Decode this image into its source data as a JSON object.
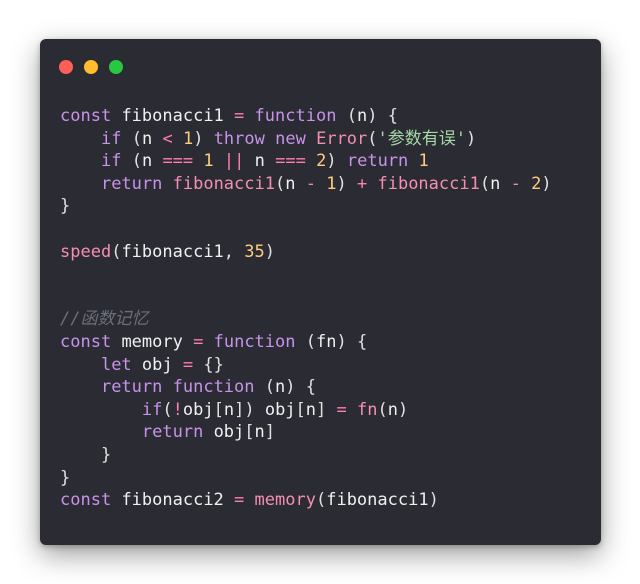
{
  "window": {
    "traffic_lights": {
      "close": {
        "icon": "close-dot-icon",
        "color": "#ff5f57"
      },
      "minimize": {
        "icon": "minimize-dot-icon",
        "color": "#febc2e"
      },
      "zoom": {
        "icon": "zoom-dot-icon",
        "color": "#28c840"
      }
    }
  },
  "colors": {
    "background": "#2b2c33",
    "keyword": "#c792ea",
    "function": "#f48fb1",
    "identifier": "#f0f0f0",
    "number": "#ffcc80",
    "string": "#a5d6a7",
    "operator": "#ff80ab",
    "comment": "#6b6f7a"
  },
  "code": {
    "lines": [
      [
        [
          "kw",
          "const"
        ],
        [
          "ws",
          " "
        ],
        [
          "id",
          "fibonacci1"
        ],
        [
          "ws",
          " "
        ],
        [
          "op",
          "="
        ],
        [
          "ws",
          " "
        ],
        [
          "kw",
          "function"
        ],
        [
          "ws",
          " "
        ],
        [
          "pn",
          "("
        ],
        [
          "id",
          "n"
        ],
        [
          "pn",
          ")"
        ],
        [
          "ws",
          " "
        ],
        [
          "pn",
          "{"
        ]
      ],
      [
        [
          "ws",
          "    "
        ],
        [
          "kw",
          "if"
        ],
        [
          "ws",
          " "
        ],
        [
          "pn",
          "("
        ],
        [
          "id",
          "n"
        ],
        [
          "ws",
          " "
        ],
        [
          "op",
          "<"
        ],
        [
          "ws",
          " "
        ],
        [
          "num",
          "1"
        ],
        [
          "pn",
          ")"
        ],
        [
          "ws",
          " "
        ],
        [
          "kw",
          "throw"
        ],
        [
          "ws",
          " "
        ],
        [
          "kw",
          "new"
        ],
        [
          "ws",
          " "
        ],
        [
          "fn",
          "Error"
        ],
        [
          "pn",
          "("
        ],
        [
          "str",
          "'参数有误'"
        ],
        [
          "pn",
          ")"
        ]
      ],
      [
        [
          "ws",
          "    "
        ],
        [
          "kw",
          "if"
        ],
        [
          "ws",
          " "
        ],
        [
          "pn",
          "("
        ],
        [
          "id",
          "n"
        ],
        [
          "ws",
          " "
        ],
        [
          "op",
          "==="
        ],
        [
          "ws",
          " "
        ],
        [
          "num",
          "1"
        ],
        [
          "ws",
          " "
        ],
        [
          "op",
          "||"
        ],
        [
          "ws",
          " "
        ],
        [
          "id",
          "n"
        ],
        [
          "ws",
          " "
        ],
        [
          "op",
          "==="
        ],
        [
          "ws",
          " "
        ],
        [
          "num",
          "2"
        ],
        [
          "pn",
          ")"
        ],
        [
          "ws",
          " "
        ],
        [
          "kw",
          "return"
        ],
        [
          "ws",
          " "
        ],
        [
          "num",
          "1"
        ]
      ],
      [
        [
          "ws",
          "    "
        ],
        [
          "kw",
          "return"
        ],
        [
          "ws",
          " "
        ],
        [
          "fn",
          "fibonacci1"
        ],
        [
          "pn",
          "("
        ],
        [
          "id",
          "n"
        ],
        [
          "ws",
          " "
        ],
        [
          "op",
          "-"
        ],
        [
          "ws",
          " "
        ],
        [
          "num",
          "1"
        ],
        [
          "pn",
          ")"
        ],
        [
          "ws",
          " "
        ],
        [
          "op",
          "+"
        ],
        [
          "ws",
          " "
        ],
        [
          "fn",
          "fibonacci1"
        ],
        [
          "pn",
          "("
        ],
        [
          "id",
          "n"
        ],
        [
          "ws",
          " "
        ],
        [
          "op",
          "-"
        ],
        [
          "ws",
          " "
        ],
        [
          "num",
          "2"
        ],
        [
          "pn",
          ")"
        ]
      ],
      [
        [
          "pn",
          "}"
        ]
      ],
      [],
      [
        [
          "fn",
          "speed"
        ],
        [
          "pn",
          "("
        ],
        [
          "id",
          "fibonacci1"
        ],
        [
          "pn",
          ","
        ],
        [
          "ws",
          " "
        ],
        [
          "num",
          "35"
        ],
        [
          "pn",
          ")"
        ]
      ],
      [],
      [],
      [
        [
          "cm",
          "//函数记忆"
        ]
      ],
      [
        [
          "kw",
          "const"
        ],
        [
          "ws",
          " "
        ],
        [
          "id",
          "memory"
        ],
        [
          "ws",
          " "
        ],
        [
          "op",
          "="
        ],
        [
          "ws",
          " "
        ],
        [
          "kw",
          "function"
        ],
        [
          "ws",
          " "
        ],
        [
          "pn",
          "("
        ],
        [
          "id",
          "fn"
        ],
        [
          "pn",
          ")"
        ],
        [
          "ws",
          " "
        ],
        [
          "pn",
          "{"
        ]
      ],
      [
        [
          "ws",
          "    "
        ],
        [
          "kw",
          "let"
        ],
        [
          "ws",
          " "
        ],
        [
          "id",
          "obj"
        ],
        [
          "ws",
          " "
        ],
        [
          "op",
          "="
        ],
        [
          "ws",
          " "
        ],
        [
          "pn",
          "{}"
        ]
      ],
      [
        [
          "ws",
          "    "
        ],
        [
          "kw",
          "return"
        ],
        [
          "ws",
          " "
        ],
        [
          "kw",
          "function"
        ],
        [
          "ws",
          " "
        ],
        [
          "pn",
          "("
        ],
        [
          "id",
          "n"
        ],
        [
          "pn",
          ")"
        ],
        [
          "ws",
          " "
        ],
        [
          "pn",
          "{"
        ]
      ],
      [
        [
          "ws",
          "        "
        ],
        [
          "kw",
          "if"
        ],
        [
          "pn",
          "("
        ],
        [
          "op",
          "!"
        ],
        [
          "id",
          "obj"
        ],
        [
          "pn",
          "["
        ],
        [
          "id",
          "n"
        ],
        [
          "pn",
          "])"
        ],
        [
          "ws",
          " "
        ],
        [
          "id",
          "obj"
        ],
        [
          "pn",
          "["
        ],
        [
          "id",
          "n"
        ],
        [
          "pn",
          "]"
        ],
        [
          "ws",
          " "
        ],
        [
          "op",
          "="
        ],
        [
          "ws",
          " "
        ],
        [
          "fn",
          "fn"
        ],
        [
          "pn",
          "("
        ],
        [
          "id",
          "n"
        ],
        [
          "pn",
          ")"
        ]
      ],
      [
        [
          "ws",
          "        "
        ],
        [
          "kw",
          "return"
        ],
        [
          "ws",
          " "
        ],
        [
          "id",
          "obj"
        ],
        [
          "pn",
          "["
        ],
        [
          "id",
          "n"
        ],
        [
          "pn",
          "]"
        ]
      ],
      [
        [
          "ws",
          "    "
        ],
        [
          "pn",
          "}"
        ]
      ],
      [
        [
          "pn",
          "}"
        ]
      ],
      [
        [
          "kw",
          "const"
        ],
        [
          "ws",
          " "
        ],
        [
          "id",
          "fibonacci2"
        ],
        [
          "ws",
          " "
        ],
        [
          "op",
          "="
        ],
        [
          "ws",
          " "
        ],
        [
          "fn",
          "memory"
        ],
        [
          "pn",
          "("
        ],
        [
          "id",
          "fibonacci1"
        ],
        [
          "pn",
          ")"
        ]
      ]
    ]
  }
}
